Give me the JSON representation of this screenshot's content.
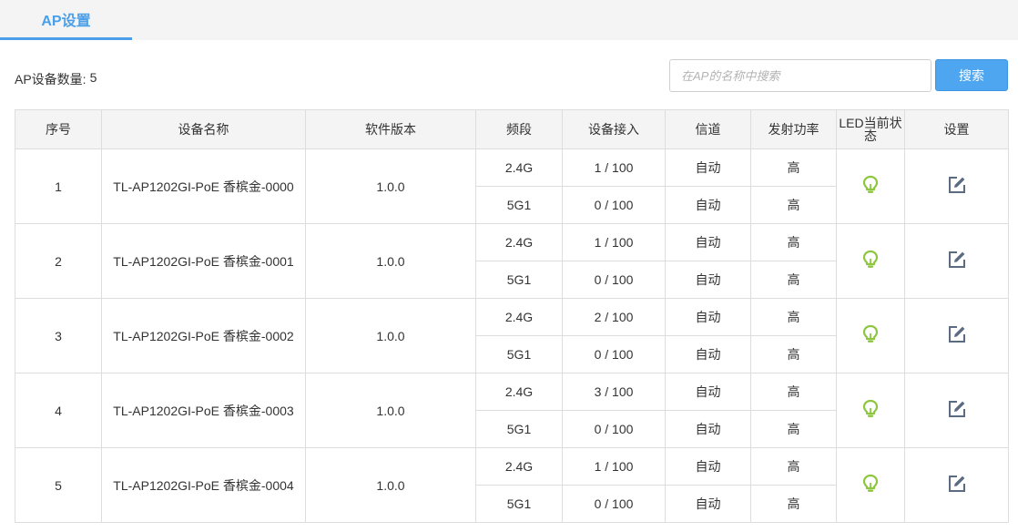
{
  "tab": {
    "label": "AP设置"
  },
  "summary": {
    "label": "AP设备数量:",
    "count": "5"
  },
  "search": {
    "placeholder": "在AP的名称中搜索",
    "value": "",
    "button_label": "搜索"
  },
  "columns": [
    "序号",
    "设备名称",
    "软件版本",
    "频段",
    "设备接入",
    "信道",
    "发射功率",
    "LED当前状态",
    "设置"
  ],
  "rows": [
    {
      "index": "1",
      "name": "TL-AP1202GI-PoE 香槟金-0000",
      "version": "1.0.0",
      "bands": [
        {
          "band": "2.4G",
          "clients": "1 / 100",
          "channel": "自动",
          "power": "高"
        },
        {
          "band": "5G1",
          "clients": "0 / 100",
          "channel": "自动",
          "power": "高"
        }
      ]
    },
    {
      "index": "2",
      "name": "TL-AP1202GI-PoE 香槟金-0001",
      "version": "1.0.0",
      "bands": [
        {
          "band": "2.4G",
          "clients": "1 / 100",
          "channel": "自动",
          "power": "高"
        },
        {
          "band": "5G1",
          "clients": "0 / 100",
          "channel": "自动",
          "power": "高"
        }
      ]
    },
    {
      "index": "3",
      "name": "TL-AP1202GI-PoE 香槟金-0002",
      "version": "1.0.0",
      "bands": [
        {
          "band": "2.4G",
          "clients": "2 / 100",
          "channel": "自动",
          "power": "高"
        },
        {
          "band": "5G1",
          "clients": "0 / 100",
          "channel": "自动",
          "power": "高"
        }
      ]
    },
    {
      "index": "4",
      "name": "TL-AP1202GI-PoE 香槟金-0003",
      "version": "1.0.0",
      "bands": [
        {
          "band": "2.4G",
          "clients": "3 / 100",
          "channel": "自动",
          "power": "高"
        },
        {
          "band": "5G1",
          "clients": "0 / 100",
          "channel": "自动",
          "power": "高"
        }
      ]
    },
    {
      "index": "5",
      "name": "TL-AP1202GI-PoE 香槟金-0004",
      "version": "1.0.0",
      "bands": [
        {
          "band": "2.4G",
          "clients": "1 / 100",
          "channel": "自动",
          "power": "高"
        },
        {
          "band": "5G1",
          "clients": "0 / 100",
          "channel": "自动",
          "power": "高"
        }
      ]
    }
  ],
  "icons": {
    "led": "lightbulb-icon",
    "settings": "edit-icon"
  },
  "colors": {
    "accent": "#4a9fe8",
    "led_on": "#8dc63f",
    "edit_icon": "#5b6c80"
  }
}
